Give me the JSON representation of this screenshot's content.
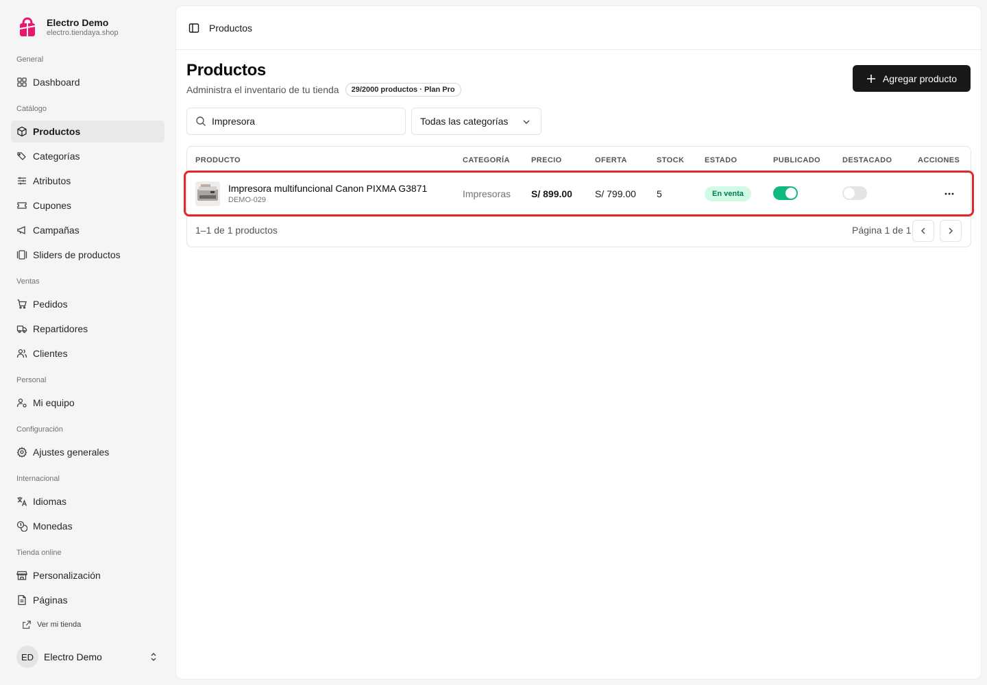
{
  "brand": {
    "name": "Electro Demo",
    "url": "electro.tiendaya.shop"
  },
  "sidebar": {
    "sections": [
      {
        "label": "General"
      },
      {
        "label": "Catálogo"
      },
      {
        "label": "Ventas"
      },
      {
        "label": "Personal"
      },
      {
        "label": "Configuración"
      },
      {
        "label": "Internacional"
      },
      {
        "label": "Tienda online"
      }
    ],
    "items": [
      {
        "label": "Dashboard",
        "icon": "grid-icon"
      },
      {
        "label": "Productos",
        "icon": "box-icon",
        "active": true
      },
      {
        "label": "Categorías",
        "icon": "tags-icon"
      },
      {
        "label": "Atributos",
        "icon": "sliders-icon"
      },
      {
        "label": "Cupones",
        "icon": "ticket-icon"
      },
      {
        "label": "Campañas",
        "icon": "megaphone-icon"
      },
      {
        "label": "Sliders de productos",
        "icon": "gallery-icon"
      },
      {
        "label": "Pedidos",
        "icon": "cart-icon"
      },
      {
        "label": "Repartidores",
        "icon": "truck-icon"
      },
      {
        "label": "Clientes",
        "icon": "users-icon"
      },
      {
        "label": "Mi equipo",
        "icon": "user-cog-icon"
      },
      {
        "label": "Ajustes generales",
        "icon": "gear-icon"
      },
      {
        "label": "Idiomas",
        "icon": "languages-icon"
      },
      {
        "label": "Monedas",
        "icon": "coins-icon"
      },
      {
        "label": "Personalización",
        "icon": "store-icon"
      },
      {
        "label": "Páginas",
        "icon": "file-icon"
      }
    ],
    "view_store": "Ver mi tienda",
    "user": {
      "initials": "ED",
      "name": "Electro Demo"
    }
  },
  "topbar": {
    "breadcrumb": "Productos"
  },
  "page": {
    "title": "Productos",
    "subtitle": "Administra el inventario de tu tienda",
    "plan_badge": "29/2000 productos · Plan Pro",
    "add_button": "Agregar producto"
  },
  "filters": {
    "search_value": "Impresora",
    "category_select": "Todas las categorías"
  },
  "table": {
    "headers": [
      "PRODUCTO",
      "CATEGORÍA",
      "PRECIO",
      "OFERTA",
      "STOCK",
      "ESTADO",
      "PUBLICADO",
      "DESTACADO",
      "ACCIONES"
    ],
    "rows": [
      {
        "name": "Impresora multifuncional Canon PIXMA G3871",
        "sku": "DEMO-029",
        "category": "Impresoras",
        "price": "S/ 899.00",
        "offer": "S/ 799.00",
        "stock": "5",
        "status": "En venta",
        "published": true,
        "featured": false
      }
    ],
    "footer_count": "1–1 de 1 productos",
    "page_info": "Página 1 de 1"
  },
  "colors": {
    "accent": "#18181b",
    "brand": "#e6186f",
    "success": "#10b981",
    "highlight": "#e5252a"
  }
}
